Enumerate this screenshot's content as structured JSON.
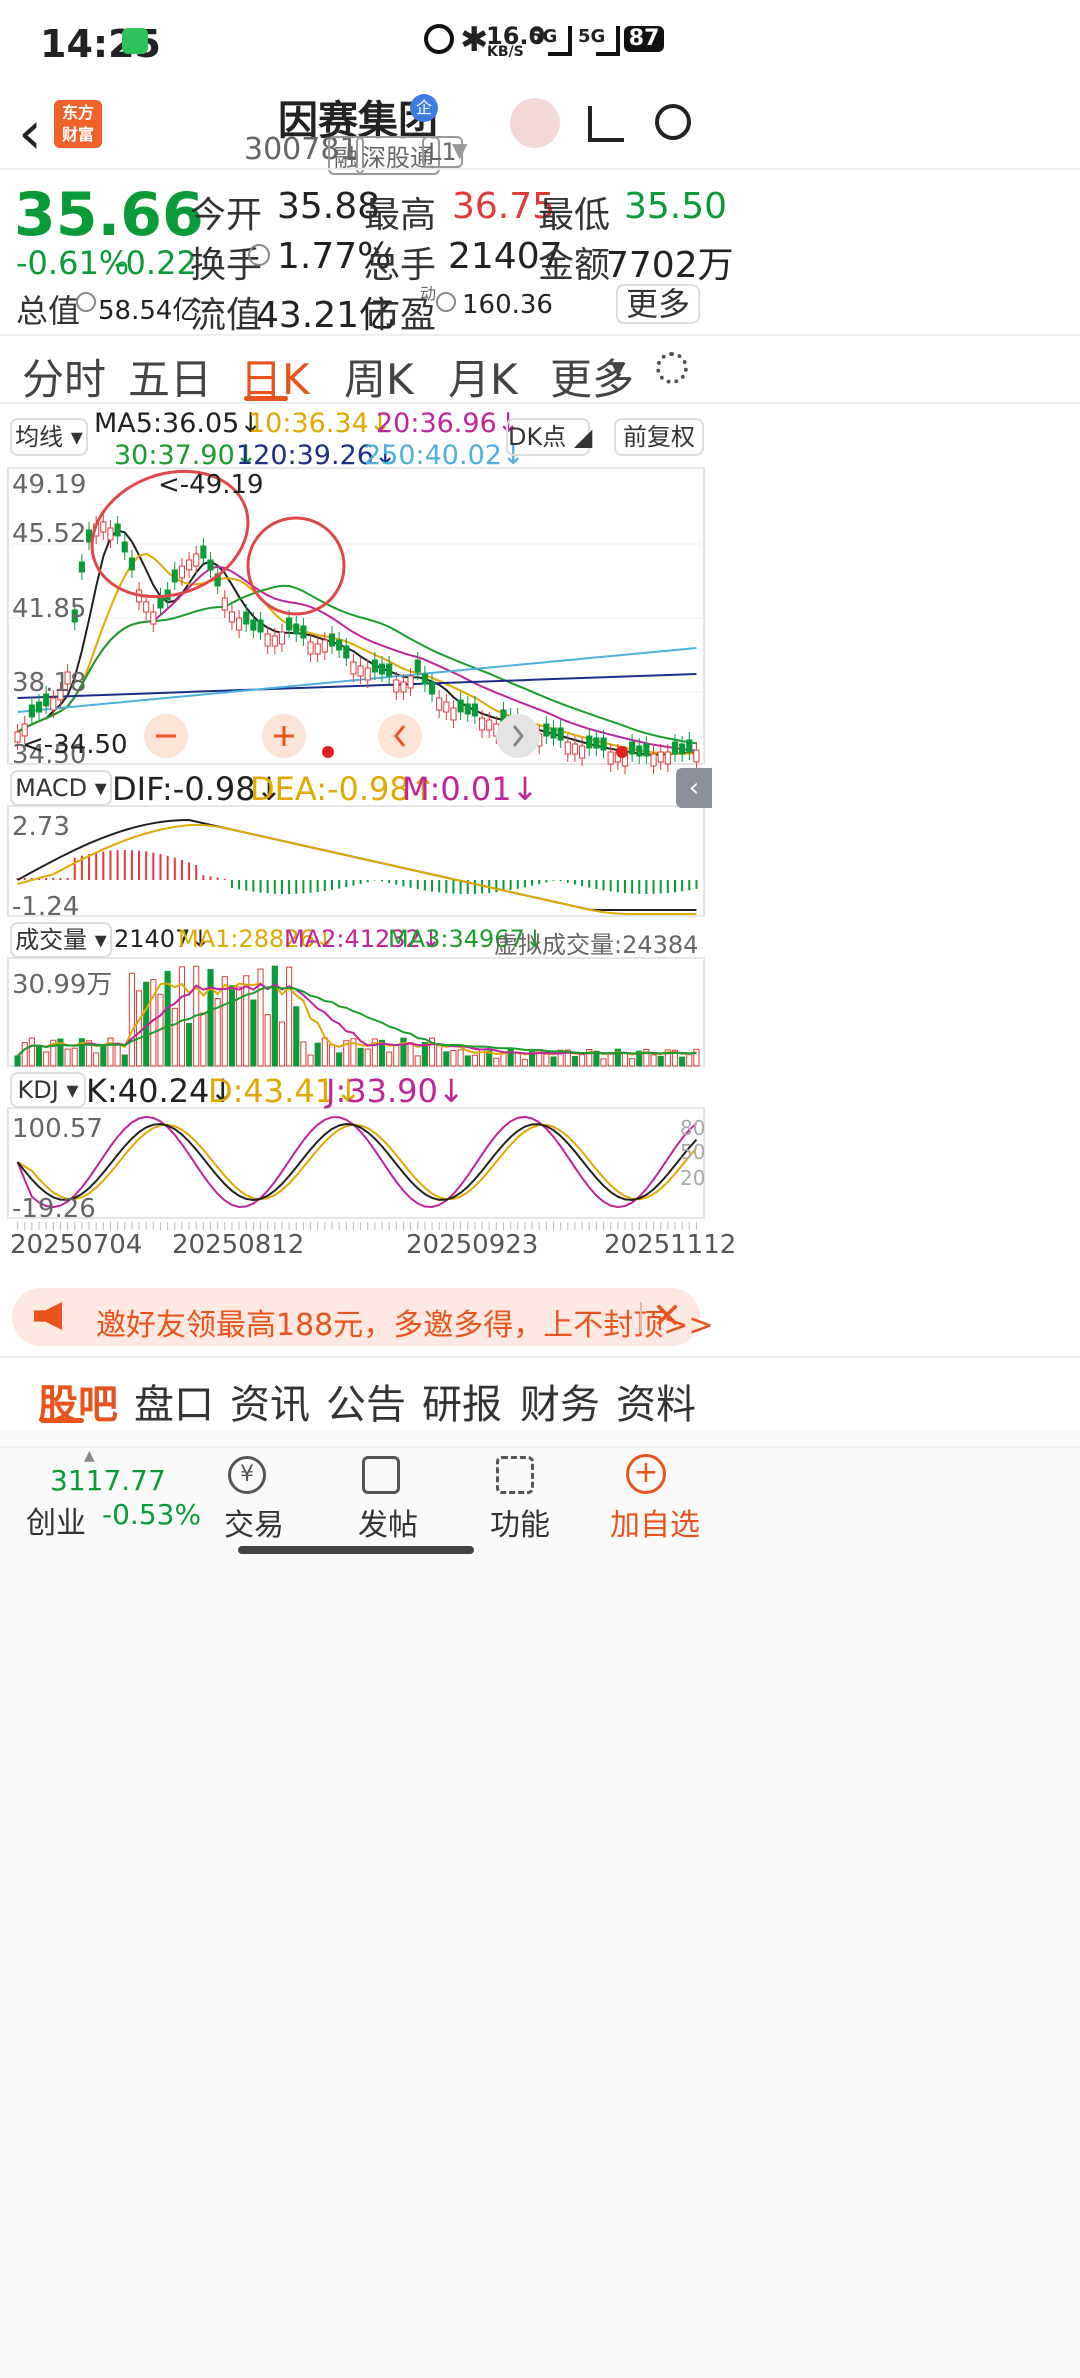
{
  "status_bar": {
    "time": "14:25",
    "net_speed": "16.0",
    "net_unit": "KB/S",
    "sig1": "5G",
    "sig2": "5G",
    "battery": "87"
  },
  "header": {
    "logo_text": "东方\n财富",
    "title": "因赛集团",
    "title_badge": "企",
    "code": "300781",
    "tags": [
      "融",
      "深股通",
      "L1"
    ]
  },
  "quote": {
    "price": "35.66",
    "change_pct": "-0.61%",
    "change_abs": "-0.22",
    "fields": [
      {
        "label": "今开",
        "value": "35.88",
        "color": "#222"
      },
      {
        "label": "最高",
        "value": "36.75",
        "color": "#e03a3a"
      },
      {
        "label": "最低",
        "value": "35.50",
        "color": "#0a9b38"
      },
      {
        "label": "换手",
        "value": "1.77%",
        "color": "#222"
      },
      {
        "label": "总手",
        "value": "21407",
        "color": "#222"
      },
      {
        "label": "金额",
        "value": "7702万",
        "color": "#222"
      },
      {
        "label": "总值",
        "value": "58.54亿",
        "color": "#222"
      },
      {
        "label": "流值",
        "value": "43.21亿",
        "color": "#222"
      },
      {
        "label": "市盈",
        "value": "160.36",
        "color": "#222"
      }
    ],
    "pe_sup": "动",
    "more_button": "更多"
  },
  "chart_tabs": [
    "分时",
    "五日",
    "日K",
    "周K",
    "月K",
    "更多"
  ],
  "active_tab": 2,
  "ma_bar": {
    "selector": "均线",
    "ma5": "MA5:36.05↓",
    "ma10": "10:36.34↓",
    "ma20": "20:36.96↓",
    "ma30": "30:37.90↓",
    "ma120": "120:39.26↓",
    "ma250": "250:40.02↓",
    "dk_button": "DK点",
    "adjust_button": "前复权"
  },
  "price_axis": {
    "top": "49.19",
    "l2": "45.52",
    "l3": "41.85",
    "l4": "38.18",
    "bottom": "34.50"
  },
  "annotations": {
    "high": "<-49.19",
    "low": "<-34.50"
  },
  "macd": {
    "selector": "MACD",
    "dif": "DIF:-0.98↓",
    "dea": "DEA:-0.98↑",
    "m": "M:0.01↓",
    "axis_top": "2.73",
    "axis_bottom": "-1.24"
  },
  "volume": {
    "selector": "成交量",
    "vol": "21407↓",
    "ma1": "MA1:28826↓",
    "ma2": "MA2:41232↓",
    "ma3": "MA3:34967↓",
    "virtual": "虚拟成交量:24384",
    "axis_top": "30.99万"
  },
  "kdj": {
    "selector": "KDJ",
    "k": "K:40.24↓",
    "d": "D:43.41↓",
    "j": "J:33.90↓",
    "axis_top": "100.57",
    "axis_bottom": "-19.26",
    "r80": "80",
    "r50": "50",
    "r20": "20"
  },
  "dates": [
    "20250704",
    "20250812",
    "20250923",
    "20251112"
  ],
  "promo": {
    "text": "邀好友领最高188元，多邀多得，上不封顶>>"
  },
  "bottom_tabs": [
    "股吧",
    "盘口",
    "资讯",
    "公告",
    "研报",
    "财务",
    "资料"
  ],
  "active_bottom_tab": 0,
  "bottom_nav": {
    "index_value": "3117.77",
    "index_name": "创业",
    "index_change": "-0.53%",
    "items": [
      "交易",
      "发帖",
      "功能",
      "加自选"
    ]
  },
  "colors": {
    "accent": "#e8541b",
    "up": "#e03a3a",
    "down": "#0a9b38"
  }
}
